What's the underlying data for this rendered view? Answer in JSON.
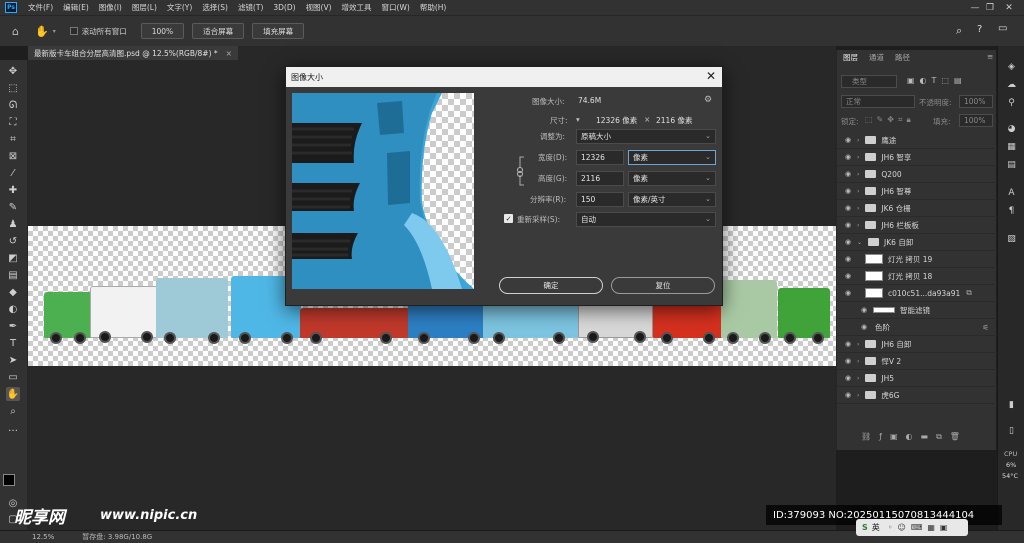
{
  "menubar": {
    "logo": "Ps",
    "items": [
      "文件(F)",
      "编辑(E)",
      "图像(I)",
      "图层(L)",
      "文字(Y)",
      "选择(S)",
      "滤镜(T)",
      "3D(D)",
      "视图(V)",
      "增效工具",
      "窗口(W)",
      "帮助(H)"
    ]
  },
  "optbar": {
    "scroll_all": "滚动所有窗口",
    "zoom_value": "100%",
    "fit_screen": "适合屏幕",
    "fill_screen": "填充屏幕"
  },
  "document": {
    "tab_title": "最新版卡车组合分层高清图.psd @ 12.5%(RGB/8#) *",
    "close": "×"
  },
  "dialog": {
    "title": "图像大小",
    "close": "✕",
    "image_size_label": "图像大小:",
    "image_size_value": "74.6M",
    "dimensions_label": "尺寸:",
    "dimensions_w": "12326 像素",
    "dimensions_x": "×",
    "dimensions_h": "2116 像素",
    "fit_to_label": "调整为:",
    "fit_to_value": "原稿大小",
    "width_label": "宽度(D):",
    "width_value": "12326",
    "width_unit": "像素",
    "height_label": "高度(G):",
    "height_value": "2116",
    "height_unit": "像素",
    "resolution_label": "分辨率(R):",
    "resolution_value": "150",
    "resolution_unit": "像素/英寸",
    "resample_label": "重新采样(S):",
    "resample_value": "自动",
    "ok": "确定",
    "reset": "复位"
  },
  "layers_panel": {
    "tabs": [
      "图层",
      "通道",
      "路径"
    ],
    "filter_kind": "类型",
    "blend_mode": "正常",
    "opacity_label": "不透明度:",
    "opacity_value": "100%",
    "lock_label": "锁定:",
    "fill_label": "填充:",
    "fill_value": "100%",
    "layers": [
      "鹰途",
      "JH6 智享",
      "Q200",
      "JH6 智尊",
      "JK6 仓栅",
      "JH6 栏板板",
      "JK6 自卸",
      "灯光 拷贝 19",
      "灯光 拷贝 18",
      "c010c51...da93a91",
      "智能滤镜",
      "色阶",
      "JH6 自卸",
      "悍V 2",
      "JH5",
      "虎6G"
    ]
  },
  "right_strip": {
    "cpu_label": "CPU",
    "cpu_value": "6%",
    "temp_value": "54°C"
  },
  "statusbar": {
    "zoom": "12.5%",
    "scratch": "暂存盘: 3.98G/10.8G"
  },
  "watermark": {
    "logo": "昵享网",
    "url": "www.nipic.cn",
    "id_text": "ID:379093 NO:20250115070813444104"
  },
  "ime": {
    "lang": "英"
  },
  "colors": {
    "ui_dark": "#323232",
    "canvas_bg": "#282828",
    "accent": "#31a8ff"
  }
}
